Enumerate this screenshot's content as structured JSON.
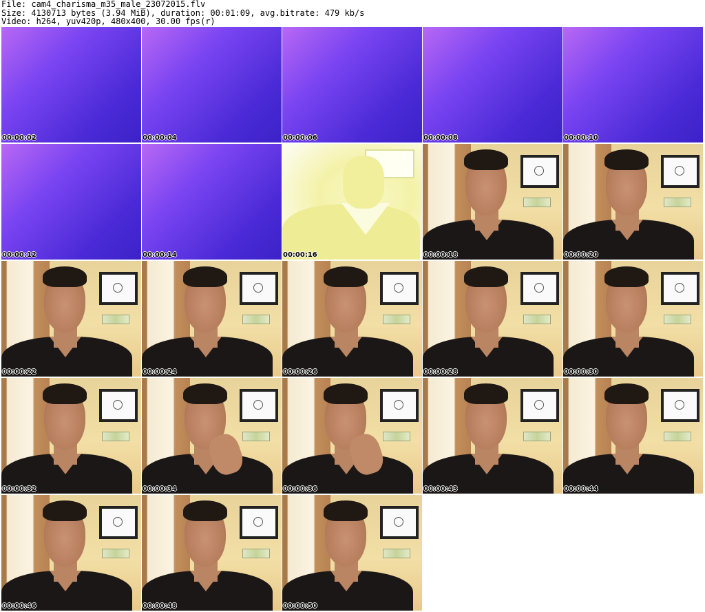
{
  "header": {
    "file_line": "File: cam4_charisma_m35_male_23072015.flv",
    "size_line": "Size: 4130713 bytes (3.94 MiB), duration: 00:01:09, avg.bitrate: 479 kb/s",
    "video_line": "Video: h264, yuv420p, 480x400, 30.00 fps(r)"
  },
  "thumbnails": [
    {
      "timestamp": "00:00:02",
      "scene": "purple"
    },
    {
      "timestamp": "00:00:04",
      "scene": "purple"
    },
    {
      "timestamp": "00:00:06",
      "scene": "purple"
    },
    {
      "timestamp": "00:00:08",
      "scene": "purple"
    },
    {
      "timestamp": "00:00:10",
      "scene": "purple"
    },
    {
      "timestamp": "00:00:12",
      "scene": "purple"
    },
    {
      "timestamp": "00:00:14",
      "scene": "purple"
    },
    {
      "timestamp": "00:00:16",
      "scene": "bright"
    },
    {
      "timestamp": "00:00:18",
      "scene": "person"
    },
    {
      "timestamp": "00:00:20",
      "scene": "person"
    },
    {
      "timestamp": "00:00:22",
      "scene": "person"
    },
    {
      "timestamp": "00:00:24",
      "scene": "person"
    },
    {
      "timestamp": "00:00:26",
      "scene": "person"
    },
    {
      "timestamp": "00:00:28",
      "scene": "person"
    },
    {
      "timestamp": "00:00:30",
      "scene": "person"
    },
    {
      "timestamp": "00:00:32",
      "scene": "person"
    },
    {
      "timestamp": "00:00:34",
      "scene": "person-hand"
    },
    {
      "timestamp": "00:00:36",
      "scene": "person-hand"
    },
    {
      "timestamp": "00:00:43",
      "scene": "person"
    },
    {
      "timestamp": "00:00:44",
      "scene": "person"
    },
    {
      "timestamp": "00:00:46",
      "scene": "person"
    },
    {
      "timestamp": "00:00:48",
      "scene": "person"
    },
    {
      "timestamp": "00:00:50",
      "scene": "person"
    }
  ]
}
